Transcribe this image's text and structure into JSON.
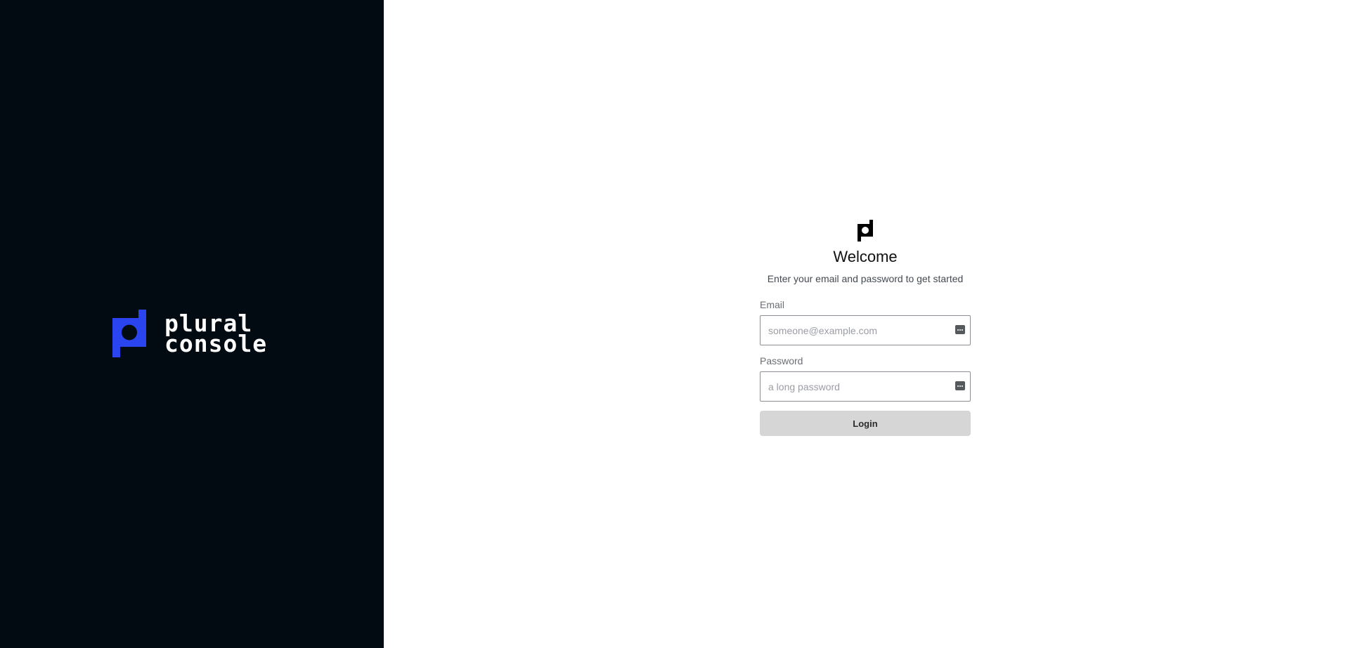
{
  "brand": {
    "wordmark_line1": "plural",
    "wordmark_line2": "console",
    "logo_icon": "plural-logo-icon",
    "accent_color": "#2a44f0",
    "panel_color": "#010b11"
  },
  "login": {
    "title": "Welcome",
    "subtitle": "Enter your email and password to get started",
    "email_label": "Email",
    "email_placeholder": "someone@example.com",
    "email_value": "",
    "password_label": "Password",
    "password_placeholder": "a long password",
    "password_value": "",
    "submit_label": "Login",
    "field_icon": "password-manager-icon"
  }
}
